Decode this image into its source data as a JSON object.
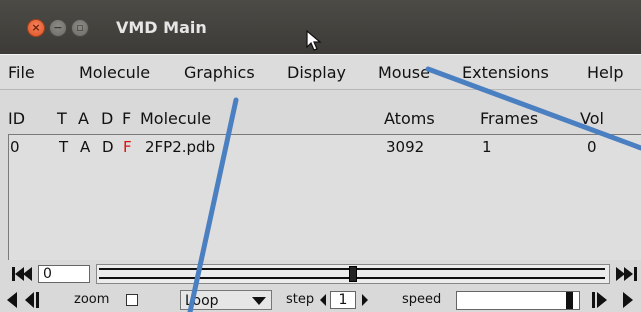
{
  "window": {
    "title": "VMD Main",
    "controls": {
      "close_glyph": "×",
      "min_glyph": "−",
      "max_glyph": "▫"
    }
  },
  "menubar": {
    "items": [
      "File",
      "Molecule",
      "Graphics",
      "Display",
      "Mouse",
      "Extensions",
      "Help"
    ]
  },
  "molecule_list": {
    "columns": {
      "id": "ID",
      "t": "T",
      "a": "A",
      "d": "D",
      "f": "F",
      "molecule": "Molecule",
      "atoms": "Atoms",
      "frames": "Frames",
      "vol": "Vol"
    },
    "rows": [
      {
        "id": "0",
        "t": "T",
        "a": "A",
        "d": "D",
        "f": "F",
        "molecule": "2FP2.pdb",
        "atoms": "3092",
        "frames": "1",
        "vol": "0"
      }
    ],
    "f_active_color": "#e01010"
  },
  "animation": {
    "current_frame": "0",
    "frame_slider_fraction": 0.5,
    "zoom_label": "zoom",
    "zoom_checked": false,
    "loop_mode": "Loop",
    "step_label": "step",
    "step_value": "1",
    "speed_label": "speed",
    "speed_fraction": 0.95
  },
  "annotation": {
    "arrow_color": "#4a7fc1",
    "arrow_count": 2
  }
}
